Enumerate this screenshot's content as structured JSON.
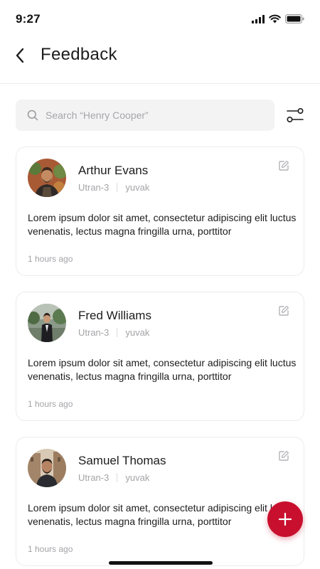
{
  "status_bar": {
    "time": "9:27"
  },
  "header": {
    "title": "Feedback"
  },
  "search": {
    "placeholder": "Search “Henry Cooper”"
  },
  "colors": {
    "accent": "#c8102e",
    "muted_text": "#a4a4a8",
    "search_bg": "#f3f3f4"
  },
  "feedback": [
    {
      "name": "Arthur Evans",
      "tag": "Utran-3",
      "user": "yuvak",
      "message": "Lorem ipsum dolor sit amet, consectetur adipiscing elit luctus venenatis, lectus magna fringilla urna, porttitor",
      "time": "1 hours ago"
    },
    {
      "name": "Fred Williams",
      "tag": "Utran-3",
      "user": "yuvak",
      "message": "Lorem ipsum dolor sit amet, consectetur adipiscing elit luctus venenatis, lectus magna fringilla urna, porttitor",
      "time": "1 hours ago"
    },
    {
      "name": "Samuel Thomas",
      "tag": "Utran-3",
      "user": "yuvak",
      "message": "Lorem ipsum dolor sit amet, consectetur adipiscing elit luctus venenatis, lectus magna fringilla urna, porttitor",
      "time": "1 hours ago"
    }
  ],
  "icons": {
    "back": "chevron-left-icon",
    "search": "search-icon",
    "filter": "filter-icon",
    "edit": "edit-icon",
    "add": "plus-icon"
  }
}
